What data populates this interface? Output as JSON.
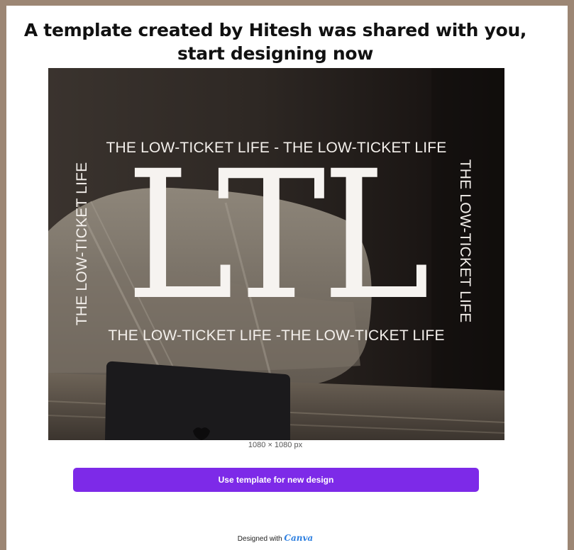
{
  "header": {
    "title": "A template created by Hitesh was shared with you, start designing now"
  },
  "preview": {
    "letters": "LTL",
    "tagline_top": "THE LOW-TICKET LIFE - THE LOW-TICKET LIFE",
    "tagline_bottom": "THE LOW-TICKET LIFE -THE LOW-TICKET LIFE",
    "tagline_left": "THE LOW-TICKET LIFE",
    "tagline_right": "THE LOW-TICKET LIFE",
    "dimensions": "1080 × 1080 px"
  },
  "actions": {
    "use_template_label": "Use template for new design"
  },
  "footer": {
    "designed_with": "Designed with",
    "brand": "Canva"
  },
  "colors": {
    "frame": "#9c8674",
    "accent": "#7d2ae8",
    "brand": "#2d7fe0"
  }
}
